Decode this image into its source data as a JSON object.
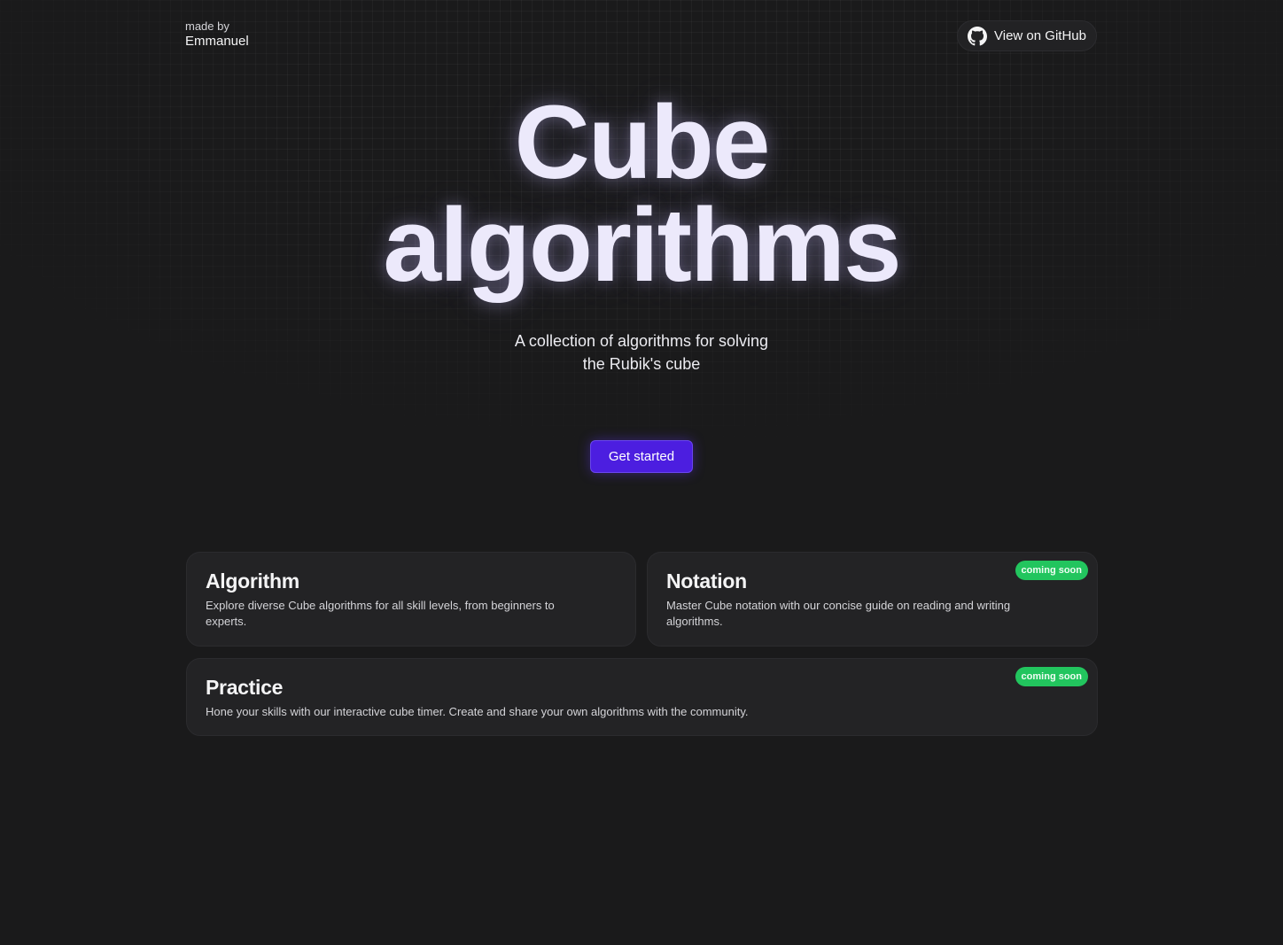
{
  "header": {
    "maker_prefix": "made by",
    "maker_name": "Emmanuel",
    "github_label": "View on GitHub",
    "github_icon": "github-icon"
  },
  "hero": {
    "title_line1": "Cube",
    "title_line2": "algorithms",
    "subtitle": "A collection of algorithms for solving the Rubik's cube",
    "cta_label": "Get started"
  },
  "cards": [
    {
      "title": "Algorithm",
      "description": "Explore diverse Cube algorithms for all skill levels, from beginners to experts.",
      "badge": ""
    },
    {
      "title": "Notation",
      "description": "Master Cube notation with our concise guide on reading and writing algorithms.",
      "badge": "coming soon"
    },
    {
      "title": "Practice",
      "description": "Hone your skills with our interactive cube timer. Create and share your own algorithms with the community.",
      "badge": "coming soon"
    }
  ],
  "colors": {
    "background": "#1a1a1b",
    "card_background": "#232325",
    "accent": "#4c1ee0",
    "badge": "#22c55e",
    "title_text": "#ece9fb"
  }
}
